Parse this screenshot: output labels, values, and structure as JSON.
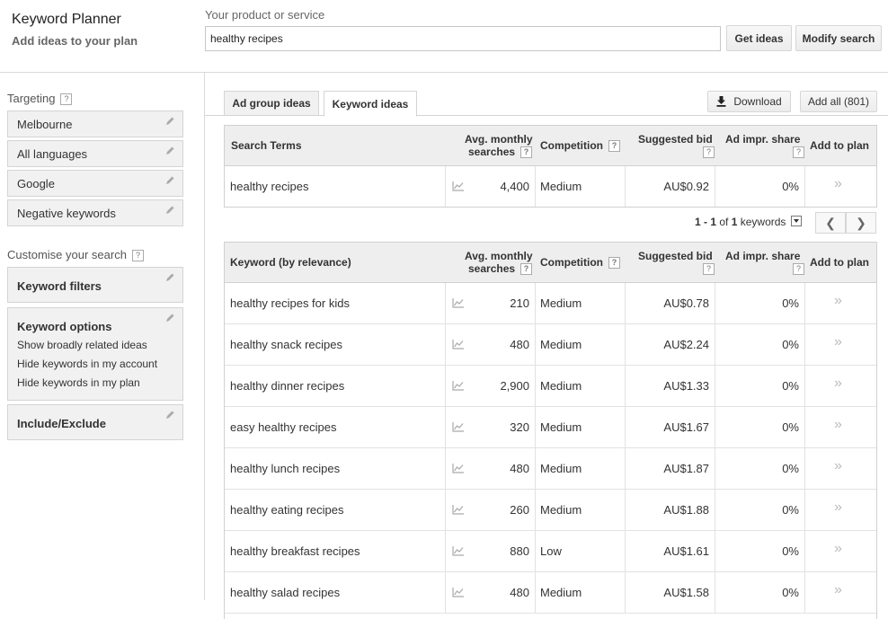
{
  "header": {
    "title": "Keyword Planner",
    "subtitle": "Add ideas to your plan",
    "product_label": "Your product or service",
    "search_value": "healthy recipes",
    "get_ideas_label": "Get ideas",
    "modify_search_label": "Modify search"
  },
  "sidebar": {
    "targeting_label": "Targeting",
    "help_glyph": "?",
    "targeting_items": [
      {
        "label": "Melbourne"
      },
      {
        "label": "All languages"
      },
      {
        "label": "Google"
      },
      {
        "label": "Negative keywords"
      }
    ],
    "customise_label": "Customise your search",
    "keyword_filters_label": "Keyword filters",
    "keyword_options": {
      "title": "Keyword options",
      "lines": [
        "Show broadly related ideas",
        "Hide keywords in my account",
        "Hide keywords in my plan"
      ]
    },
    "include_exclude_label": "Include/Exclude"
  },
  "tabs": {
    "ad_group_ideas": "Ad group ideas",
    "keyword_ideas": "Keyword ideas",
    "download_label": "Download",
    "add_all_label": "Add all (801)"
  },
  "search_terms_table": {
    "headers": {
      "term": "Search Terms",
      "avg_line1": "Avg. monthly",
      "avg_line2": "searches",
      "competition": "Competition",
      "bid": "Suggested bid",
      "impr": "Ad impr. share",
      "add": "Add to plan"
    },
    "rows": [
      {
        "keyword": "healthy recipes",
        "searches": "4,400",
        "competition": "Medium",
        "bid": "AU$0.92",
        "impr": "0%"
      }
    ]
  },
  "pager": {
    "range": "1 - 1",
    "of": "of",
    "total": "1",
    "unit": "keywords"
  },
  "keyword_table": {
    "headers": {
      "term": "Keyword (by relevance)",
      "avg_line1": "Avg. monthly",
      "avg_line2": "searches",
      "competition": "Competition",
      "bid": "Suggested bid",
      "impr": "Ad impr. share",
      "add": "Add to plan"
    },
    "rows": [
      {
        "keyword": "healthy recipes for kids",
        "searches": "210",
        "competition": "Medium",
        "bid": "AU$0.78",
        "impr": "0%"
      },
      {
        "keyword": "healthy snack recipes",
        "searches": "480",
        "competition": "Medium",
        "bid": "AU$2.24",
        "impr": "0%"
      },
      {
        "keyword": "healthy dinner recipes",
        "searches": "2,900",
        "competition": "Medium",
        "bid": "AU$1.33",
        "impr": "0%"
      },
      {
        "keyword": "easy healthy recipes",
        "searches": "320",
        "competition": "Medium",
        "bid": "AU$1.67",
        "impr": "0%"
      },
      {
        "keyword": "healthy lunch recipes",
        "searches": "480",
        "competition": "Medium",
        "bid": "AU$1.87",
        "impr": "0%"
      },
      {
        "keyword": "healthy eating recipes",
        "searches": "260",
        "competition": "Medium",
        "bid": "AU$1.88",
        "impr": "0%"
      },
      {
        "keyword": "healthy breakfast recipes",
        "searches": "880",
        "competition": "Low",
        "bid": "AU$1.61",
        "impr": "0%"
      },
      {
        "keyword": "healthy salad recipes",
        "searches": "480",
        "competition": "Medium",
        "bid": "AU$1.58",
        "impr": "0%"
      }
    ]
  },
  "icons": {
    "pencil": "pencil-icon",
    "download": "download-icon",
    "trend": "trend-chart-icon",
    "add": "double-chevron-right-icon",
    "prev": "chevron-left-icon",
    "next": "chevron-right-icon"
  }
}
